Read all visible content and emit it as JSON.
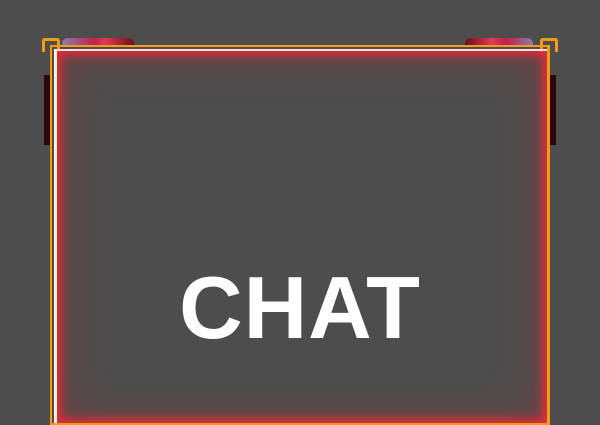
{
  "overlay": {
    "title": "CHAT"
  },
  "colors": {
    "background": "#4d4d4d",
    "frame": "#f59a12",
    "glow": "#ff2832",
    "text": "#ffffff"
  }
}
